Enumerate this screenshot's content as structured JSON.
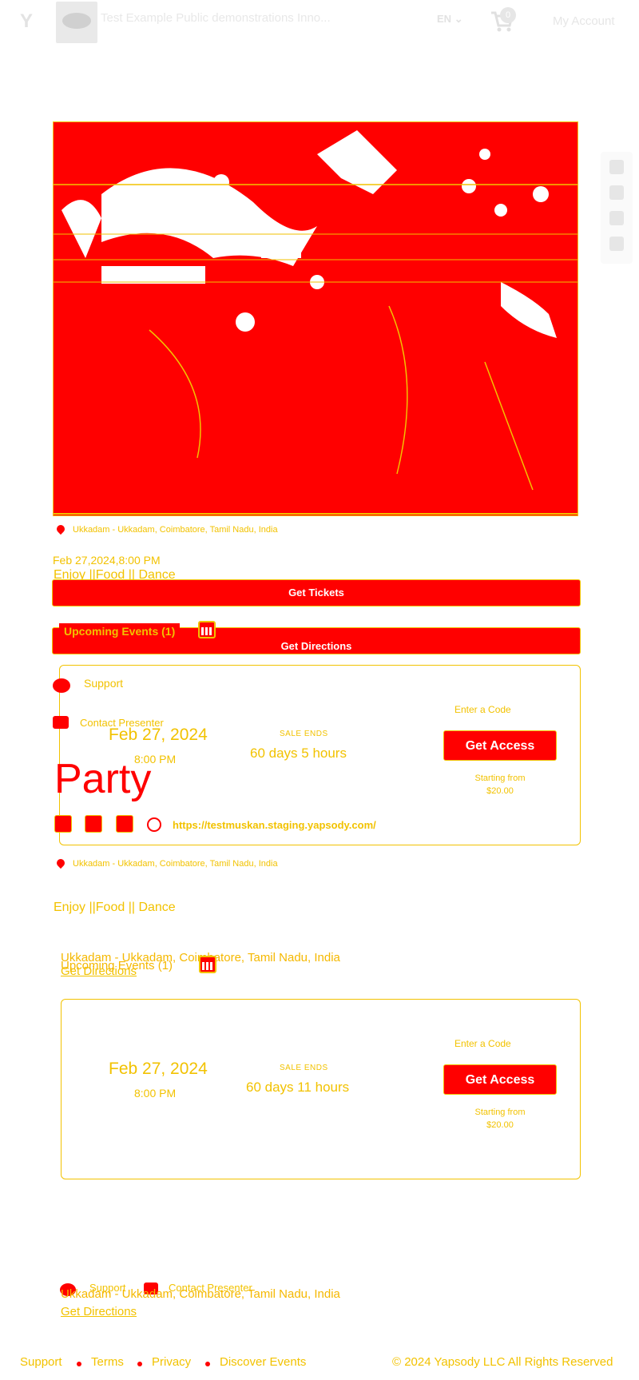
{
  "header": {
    "logo": "Y",
    "title": "Test Example Public demonstrations Inno...",
    "lang": "EN",
    "cart_count": "0",
    "my_account": "My Account"
  },
  "event": {
    "location": "Ukkadam - Ukkadam, Coimbatore, Tamil Nadu, India",
    "datetime": "Feb 27,2024,8:00 PM",
    "tags": "Enjoy ||Food || Dance",
    "get_tickets": "Get Tickets",
    "get_directions": "Get Directions",
    "upcoming_events": "Upcoming Events (1)",
    "name": "Party",
    "website": "https://testmuskan.staging.yapsody.com/"
  },
  "card1": {
    "support": "Support",
    "contact": "Contact Presenter",
    "date": "Feb 27, 2024",
    "time": "8:00 PM",
    "sale_ends_label": "SALE ENDS",
    "countdown": "60 days 5 hours",
    "enter_code": "Enter a Code",
    "access_btn": "Get Access",
    "starting_from": "Starting from",
    "price": "$20.00"
  },
  "card2": {
    "date": "Feb 27, 2024",
    "time": "8:00 PM",
    "sale_ends_label": "SALE ENDS",
    "countdown": "60 days 11 hours",
    "enter_code": "Enter a Code",
    "access_btn": "Get Access",
    "starting_from": "Starting from",
    "price": "$20.00"
  },
  "lower": {
    "location": "Ukkadam - Ukkadam, Coimbatore, Tamil Nadu, India",
    "tags": "Enjoy ||Food || Dance",
    "get_directions": "Get Directions",
    "upcoming_events": "Upcoming Events (1)",
    "support": "Support",
    "contact": "Contact Presenter"
  },
  "footer": {
    "support": "Support",
    "terms": "Terms",
    "privacy": "Privacy",
    "discover": "Discover Events",
    "copyright": "© 2024 Yapsody LLC All Rights Reserved"
  },
  "colors": {
    "accent": "#ff0000",
    "text": "#f2c200",
    "muted": "#e6e6e6"
  }
}
